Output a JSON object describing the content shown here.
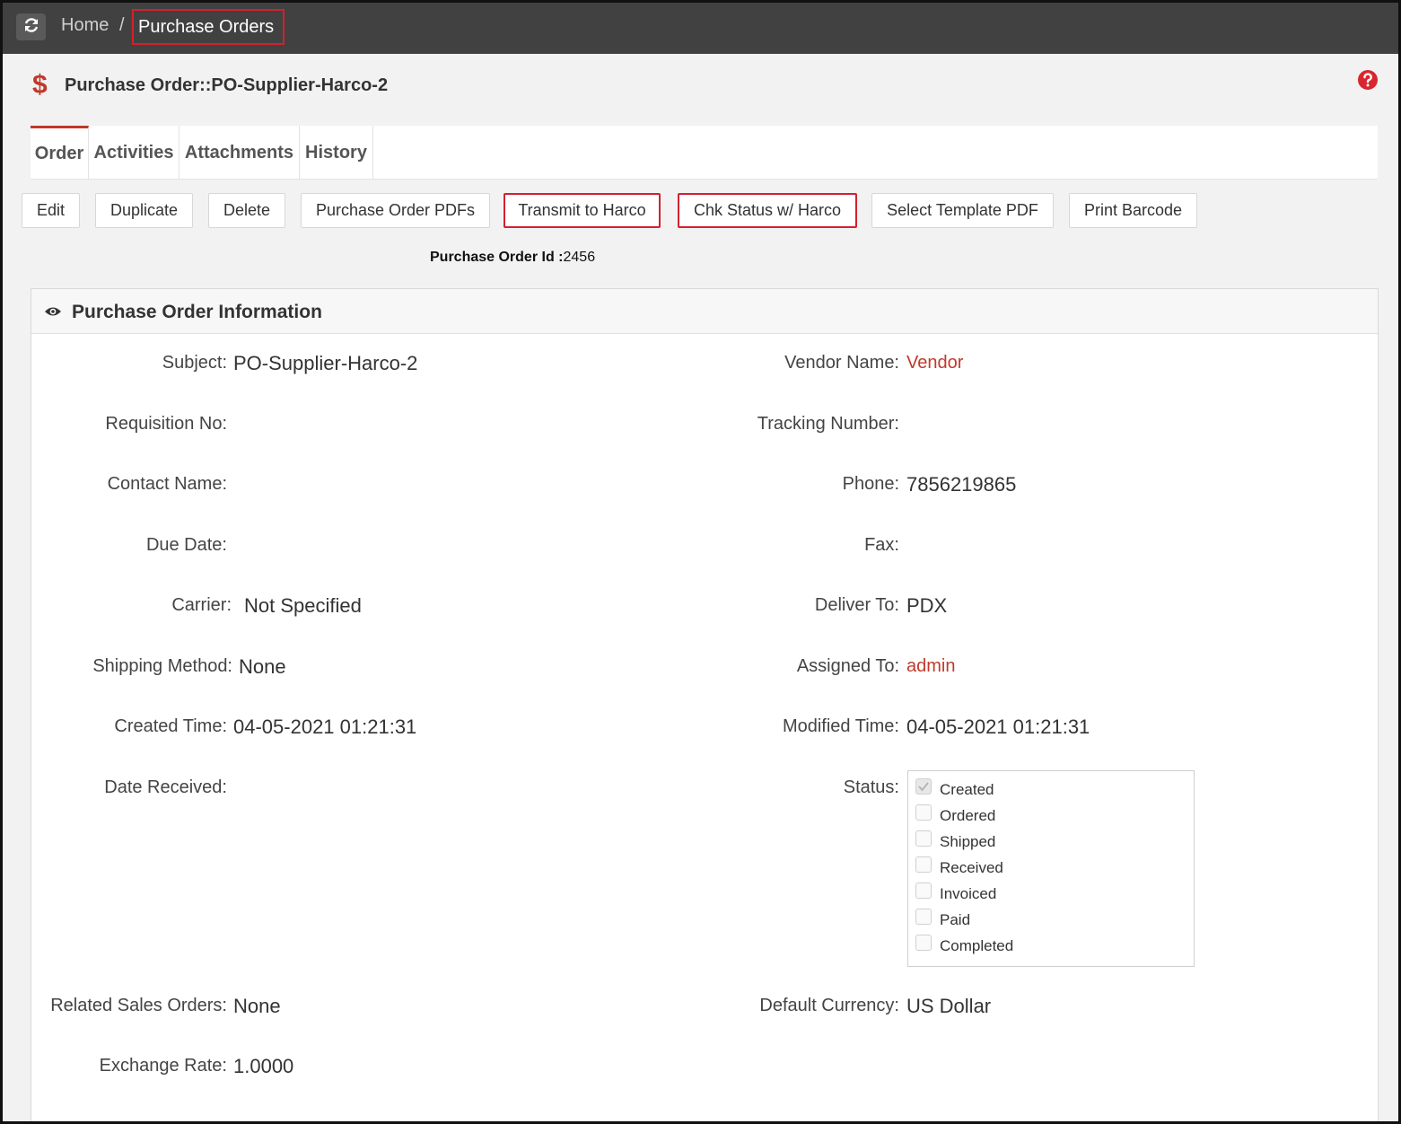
{
  "breadcrumb": {
    "home": "Home",
    "separator": "/",
    "current": "Purchase Orders"
  },
  "page": {
    "title": "Purchase Order::PO-Supplier-Harco-2",
    "icon": "dollar-icon"
  },
  "tabs": [
    {
      "label": "Order",
      "active": true
    },
    {
      "label": "Activities",
      "active": false
    },
    {
      "label": "Attachments",
      "active": false
    },
    {
      "label": "History",
      "active": false
    }
  ],
  "toolbar": {
    "edit": "Edit",
    "duplicate": "Duplicate",
    "delete": "Delete",
    "pdfs": "Purchase Order PDFs",
    "transmit": "Transmit to Harco",
    "chk_status": "Chk Status w/ Harco",
    "select_template": "Select Template PDF",
    "print_barcode": "Print Barcode"
  },
  "po_id": {
    "label": "Purchase Order Id :",
    "value": "2456"
  },
  "panel": {
    "title": "Purchase Order Information"
  },
  "fields": {
    "subject": {
      "label": "Subject:",
      "value": "PO-Supplier-Harco-2"
    },
    "vendor_name": {
      "label": "Vendor Name:",
      "value": "Vendor"
    },
    "requisition_no": {
      "label": "Requisition No:",
      "value": ""
    },
    "tracking_number": {
      "label": "Tracking Number:",
      "value": ""
    },
    "contact_name": {
      "label": "Contact Name:",
      "value": ""
    },
    "phone": {
      "label": "Phone:",
      "value": "7856219865"
    },
    "due_date": {
      "label": "Due Date:",
      "value": ""
    },
    "fax": {
      "label": "Fax:",
      "value": ""
    },
    "carrier": {
      "label": "Carrier:",
      "value": "Not Specified"
    },
    "deliver_to": {
      "label": "Deliver To:",
      "value": "PDX"
    },
    "shipping_method": {
      "label": "Shipping Method:",
      "value": "None"
    },
    "assigned_to": {
      "label": "Assigned To:",
      "value": "admin"
    },
    "created_time": {
      "label": "Created Time:",
      "value": "04-05-2021 01:21:31"
    },
    "modified_time": {
      "label": "Modified Time:",
      "value": "04-05-2021 01:21:31"
    },
    "date_received": {
      "label": "Date Received:",
      "value": ""
    },
    "status": {
      "label": "Status:"
    },
    "related_sales_orders": {
      "label": "Related Sales Orders:",
      "value": "None"
    },
    "default_currency": {
      "label": "Default Currency:",
      "value": "US Dollar"
    },
    "exchange_rate": {
      "label": "Exchange Rate:",
      "value": "1.0000"
    }
  },
  "status_options": [
    {
      "label": "Created",
      "checked": true
    },
    {
      "label": "Ordered",
      "checked": false
    },
    {
      "label": "Shipped",
      "checked": false
    },
    {
      "label": "Received",
      "checked": false
    },
    {
      "label": "Invoiced",
      "checked": false
    },
    {
      "label": "Paid",
      "checked": false
    },
    {
      "label": "Completed",
      "checked": false
    }
  ],
  "colors": {
    "accent": "#c0392b",
    "highlight": "#d4202e",
    "topbar": "#414141"
  }
}
